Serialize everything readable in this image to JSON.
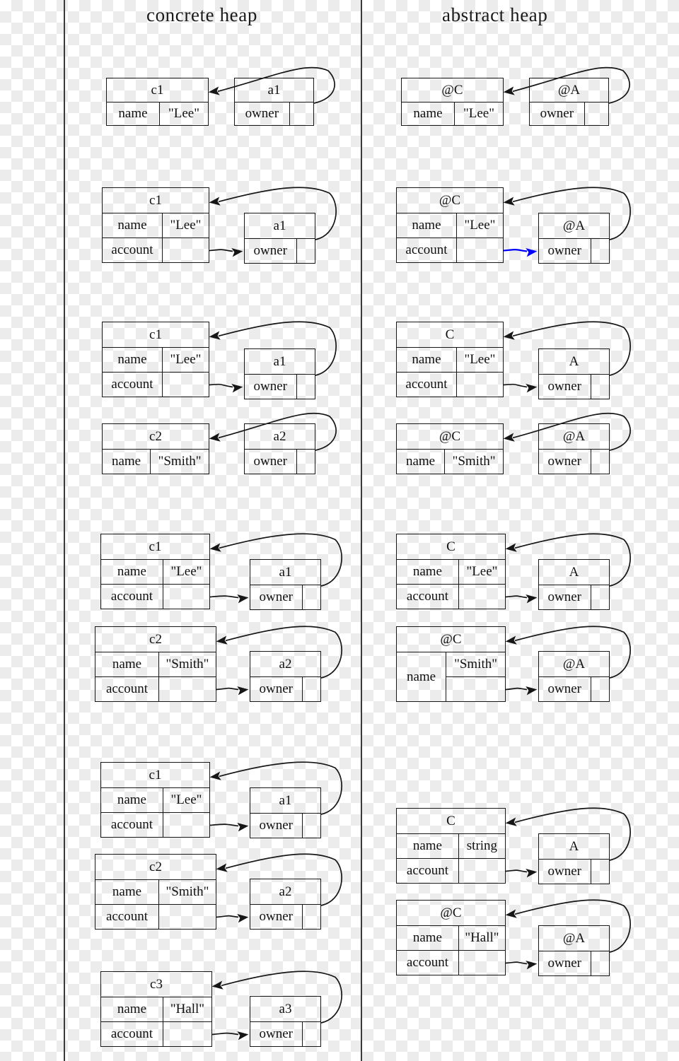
{
  "headers": {
    "left": "concrete heap",
    "right": "abstract heap"
  },
  "field_labels": {
    "name": "name",
    "account": "account",
    "owner": "owner"
  },
  "colors": {
    "stroke": "#161616",
    "highlight_arrow": "#0000ff",
    "separator": "#3a3a3a"
  },
  "rows": [
    {
      "id": "row-1",
      "concrete": {
        "objects": [
          {
            "title": "c1",
            "fields": [
              {
                "label": "name",
                "value": "\"Lee\""
              }
            ]
          },
          {
            "title": "a1",
            "fields": [
              {
                "label": "owner",
                "value": ""
              }
            ]
          }
        ]
      },
      "abstract": {
        "objects": [
          {
            "title": "@C",
            "fields": [
              {
                "label": "name",
                "value": "\"Lee\""
              }
            ]
          },
          {
            "title": "@A",
            "fields": [
              {
                "label": "owner",
                "value": ""
              }
            ]
          }
        ]
      }
    },
    {
      "id": "row-2",
      "concrete": {
        "objects": [
          {
            "title": "c1",
            "fields": [
              {
                "label": "name",
                "value": "\"Lee\""
              },
              {
                "label": "account",
                "value": ""
              }
            ]
          },
          {
            "title": "a1",
            "fields": [
              {
                "label": "owner",
                "value": ""
              }
            ]
          }
        ]
      },
      "abstract": {
        "objects": [
          {
            "title": "@C",
            "fields": [
              {
                "label": "name",
                "value": "\"Lee\""
              },
              {
                "label": "account",
                "value": ""
              }
            ]
          },
          {
            "title": "@A",
            "fields": [
              {
                "label": "owner",
                "value": ""
              }
            ]
          }
        ]
      }
    },
    {
      "id": "row-3",
      "concrete": {
        "objects": [
          {
            "title": "c1",
            "fields": [
              {
                "label": "name",
                "value": "\"Lee\""
              },
              {
                "label": "account",
                "value": ""
              }
            ]
          },
          {
            "title": "a1",
            "fields": [
              {
                "label": "owner",
                "value": ""
              }
            ]
          },
          {
            "title": "c2",
            "fields": [
              {
                "label": "name",
                "value": "\"Smith\""
              }
            ]
          },
          {
            "title": "a2",
            "fields": [
              {
                "label": "owner",
                "value": ""
              }
            ]
          }
        ]
      },
      "abstract": {
        "objects": [
          {
            "title": "C",
            "fields": [
              {
                "label": "name",
                "value": "\"Lee\""
              },
              {
                "label": "account",
                "value": ""
              }
            ]
          },
          {
            "title": "A",
            "fields": [
              {
                "label": "owner",
                "value": ""
              }
            ]
          },
          {
            "title": "@C",
            "fields": [
              {
                "label": "name",
                "value": "\"Smith\""
              }
            ]
          },
          {
            "title": "@A",
            "fields": [
              {
                "label": "owner",
                "value": ""
              }
            ]
          }
        ]
      }
    },
    {
      "id": "row-4",
      "concrete": {
        "objects": [
          {
            "title": "c1",
            "fields": [
              {
                "label": "name",
                "value": "\"Lee\""
              },
              {
                "label": "account",
                "value": ""
              }
            ]
          },
          {
            "title": "a1",
            "fields": [
              {
                "label": "owner",
                "value": ""
              }
            ]
          },
          {
            "title": "c2",
            "fields": [
              {
                "label": "name",
                "value": "\"Smith\""
              },
              {
                "label": "account",
                "value": ""
              }
            ]
          },
          {
            "title": "a2",
            "fields": [
              {
                "label": "owner",
                "value": ""
              }
            ]
          }
        ]
      },
      "abstract": {
        "objects": [
          {
            "title": "C",
            "fields": [
              {
                "label": "name",
                "value": "\"Lee\""
              },
              {
                "label": "account",
                "value": ""
              }
            ]
          },
          {
            "title": "A",
            "fields": [
              {
                "label": "owner",
                "value": ""
              }
            ]
          },
          {
            "title": "@C",
            "merged_name_cell": true,
            "fields": [
              {
                "label": "name",
                "value": "\"Smith\"",
                "value_below": ""
              }
            ]
          },
          {
            "title": "@A",
            "fields": [
              {
                "label": "owner",
                "value": ""
              }
            ]
          }
        ]
      }
    },
    {
      "id": "row-5",
      "concrete": {
        "objects": [
          {
            "title": "c1",
            "fields": [
              {
                "label": "name",
                "value": "\"Lee\""
              },
              {
                "label": "account",
                "value": ""
              }
            ]
          },
          {
            "title": "a1",
            "fields": [
              {
                "label": "owner",
                "value": ""
              }
            ]
          },
          {
            "title": "c2",
            "fields": [
              {
                "label": "name",
                "value": "\"Smith\""
              },
              {
                "label": "account",
                "value": ""
              }
            ]
          },
          {
            "title": "a2",
            "fields": [
              {
                "label": "owner",
                "value": ""
              }
            ]
          },
          {
            "title": "c3",
            "fields": [
              {
                "label": "name",
                "value": "\"Hall\""
              },
              {
                "label": "account",
                "value": ""
              }
            ]
          },
          {
            "title": "a3",
            "fields": [
              {
                "label": "owner",
                "value": ""
              }
            ]
          }
        ]
      },
      "abstract": {
        "objects": [
          {
            "title": "C",
            "fields": [
              {
                "label": "name",
                "value": "string"
              },
              {
                "label": "account",
                "value": ""
              }
            ]
          },
          {
            "title": "A",
            "fields": [
              {
                "label": "owner",
                "value": ""
              }
            ]
          },
          {
            "title": "@C",
            "fields": [
              {
                "label": "name",
                "value": "\"Hall\""
              },
              {
                "label": "account",
                "value": ""
              }
            ]
          },
          {
            "title": "@A",
            "fields": [
              {
                "label": "owner",
                "value": ""
              }
            ]
          }
        ]
      }
    }
  ]
}
